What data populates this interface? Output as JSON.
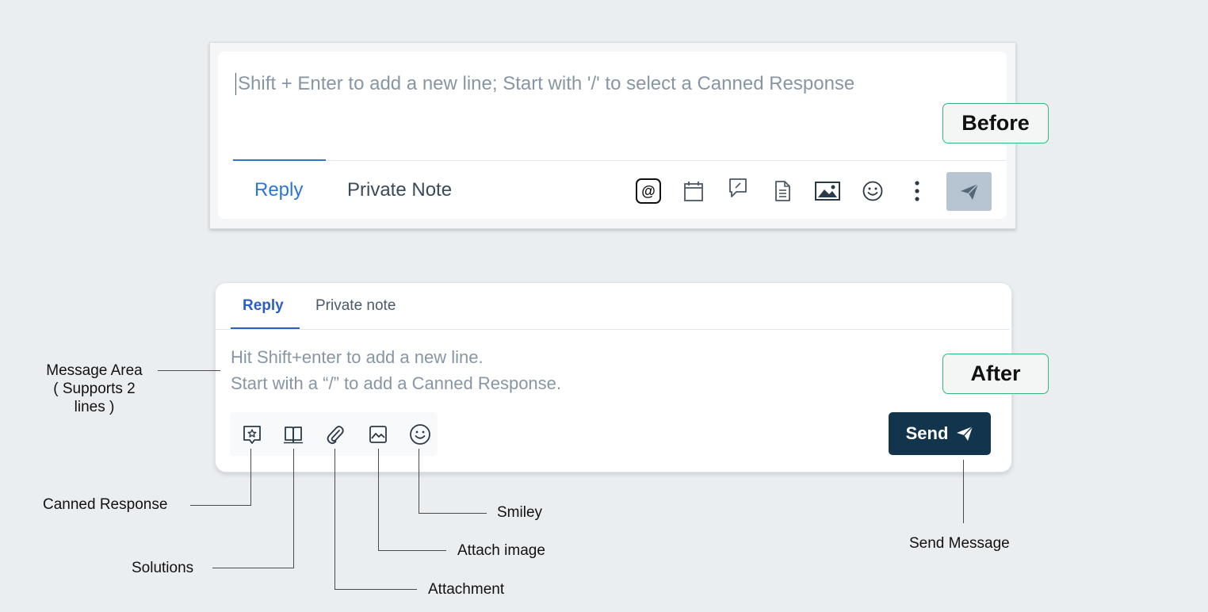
{
  "before": {
    "tag": "Before",
    "placeholder": "Shift + Enter to add a new line; Start with '/' to select a Canned Response",
    "tabs": {
      "reply": "Reply",
      "private_note": "Private Note"
    },
    "toolbar_icons": [
      "mention-icon",
      "calendar-icon",
      "comment-icon",
      "document-icon",
      "image-icon",
      "smiley-icon",
      "more-vertical-icon"
    ],
    "send_icon": "send-plane-icon"
  },
  "after": {
    "tag": "After",
    "tabs": {
      "reply": "Reply",
      "private_note": "Private note"
    },
    "placeholder_line1": "Hit Shift+enter to add a new line.",
    "placeholder_line2": "Start with a “/” to add a Canned Response.",
    "toolbar_icons": [
      "canned-response-icon",
      "solutions-icon",
      "attachment-icon",
      "attach-image-icon",
      "smiley-icon"
    ],
    "send_label": "Send",
    "colors": {
      "send_bg": "#12344d",
      "accent": "#2c5ec4",
      "tag_border": "#35b77a"
    }
  },
  "annotations": {
    "message_area_line1": "Message Area",
    "message_area_line2": "( Supports 2",
    "message_area_line3": "lines )",
    "canned_response": "Canned Response",
    "solutions": "Solutions",
    "attachment": "Attachment",
    "attach_image": "Attach image",
    "smiley": "Smiley",
    "send_message": "Send Message"
  }
}
